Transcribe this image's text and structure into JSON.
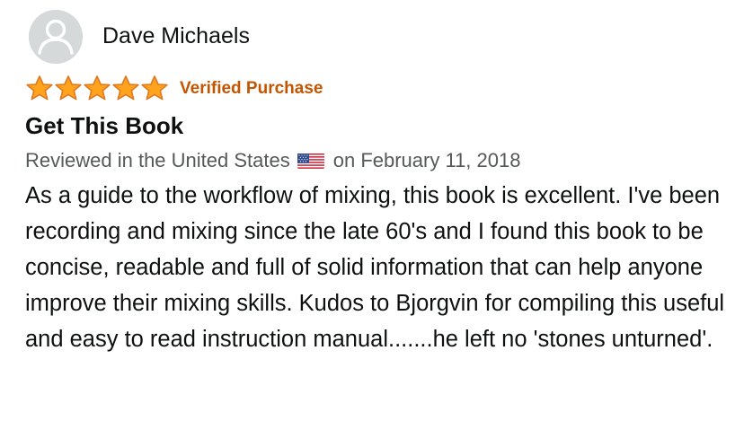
{
  "reviewer": {
    "name": "Dave Michaels",
    "avatar_icon": "default-avatar-icon"
  },
  "rating": {
    "stars": 5,
    "max_stars": 5,
    "star_color": "#ffa41c",
    "star_outline_color": "#de7921",
    "badge": "Verified Purchase",
    "badge_color": "#c45500"
  },
  "review": {
    "title": "Get This Book",
    "meta_prefix": "Reviewed in the United States",
    "flag_icon": "us-flag-icon",
    "meta_suffix": "on February 11, 2018",
    "body": "As a guide to the workflow of mixing, this book is excellent. I've been recording and mixing since the late 60's and I found this book to be concise, readable and full of solid information that can help anyone improve their mixing skills. Kudos to Bjorgvin for compiling this useful and easy to read instruction manual.......he left no 'stones unturned'."
  }
}
